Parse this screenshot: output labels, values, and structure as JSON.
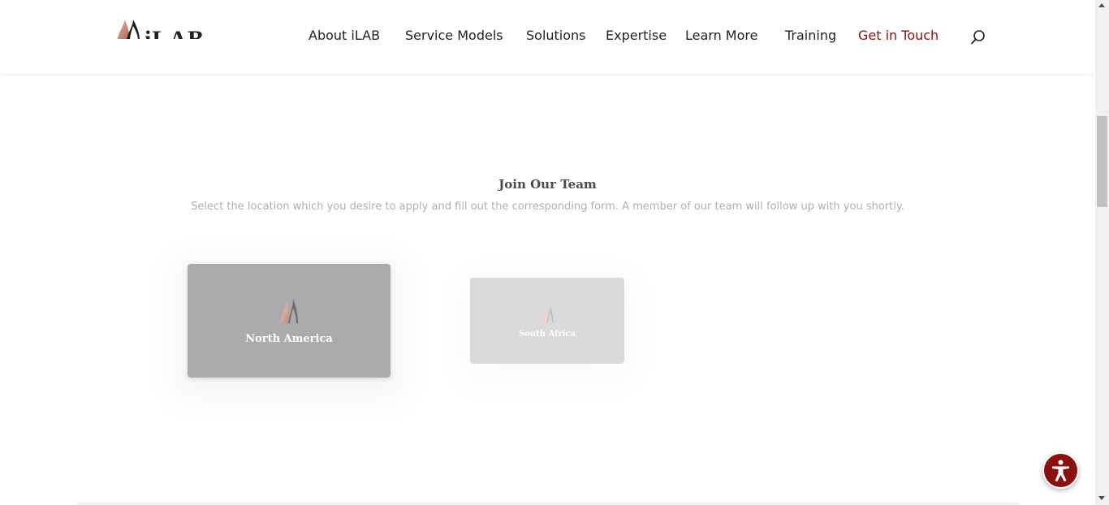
{
  "header": {
    "logo_text": "iLAB",
    "nav": [
      {
        "label": "About iLAB"
      },
      {
        "label": "Service Models"
      },
      {
        "label": "Solutions"
      },
      {
        "label": "Expertise"
      },
      {
        "label": "Learn More"
      },
      {
        "label": "Training"
      },
      {
        "label": "Get in Touch"
      }
    ],
    "cta_color": "#8b1010",
    "search_icon": "search-icon"
  },
  "main": {
    "title": "Join Our Team",
    "subtitle": "Select the location which you desire to apply and fill out the corresponding form. A member of our team will follow up with you shortly.",
    "cards": [
      {
        "label": "North America",
        "icon": "flame-logo-icon"
      },
      {
        "label": "South Africa",
        "icon": "flame-logo-icon"
      }
    ]
  },
  "accessibility": {
    "icon": "accessibility-icon",
    "color": "#8b1010"
  }
}
